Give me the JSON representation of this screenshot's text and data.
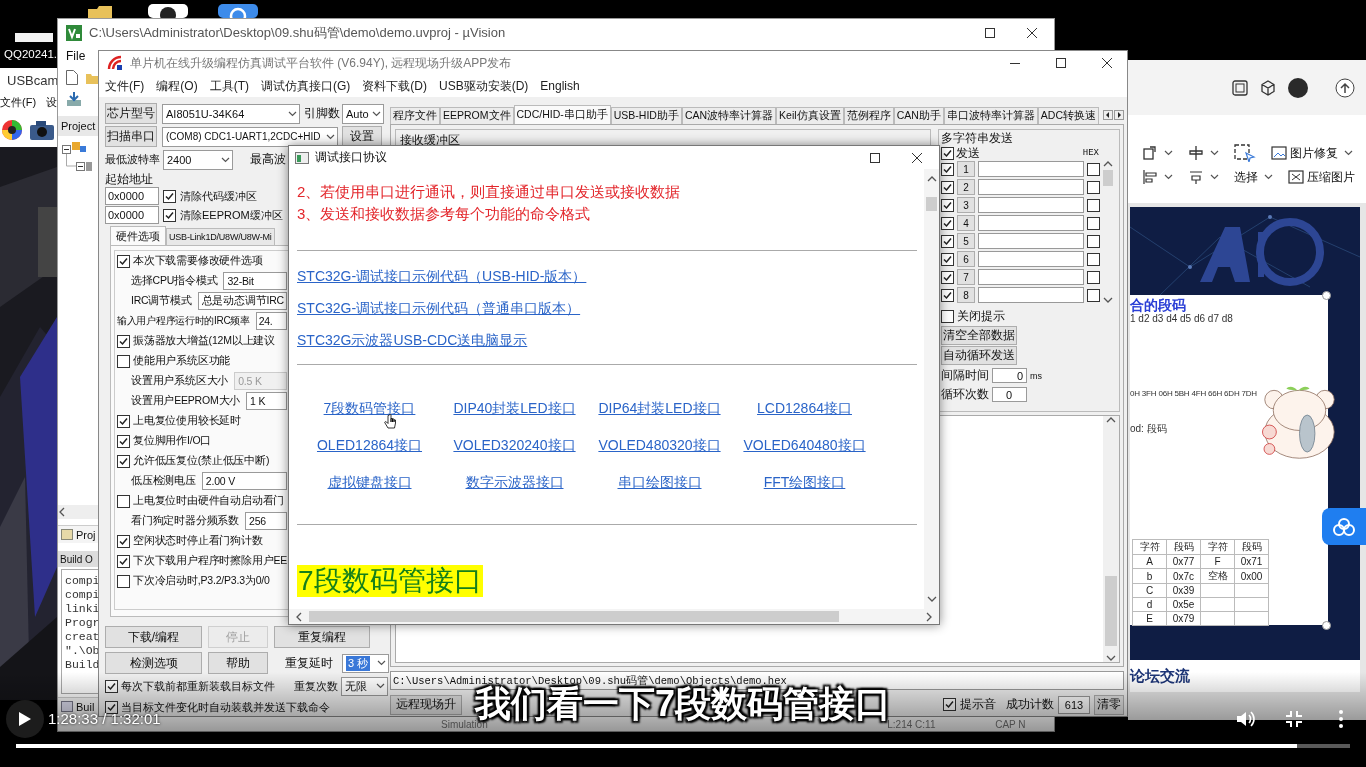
{
  "desktop": {
    "file_label": "QQ20241."
  },
  "usbcam_window": {
    "title": "USBcam",
    "menu": [
      "文件(F)",
      "设"
    ]
  },
  "keil_window": {
    "title": "C:\\Users\\Administrator\\Desktop\\09.shu码管\\demo\\demo.uvproj - µVision",
    "menu": [
      "File"
    ],
    "project_label": "Project",
    "project_tab": "Proj",
    "build_output_title": "Build O",
    "build_output_lines": [
      "compi",
      "compi",
      "linki",
      "Progr",
      "creat",
      "\".\\Ob",
      "Build"
    ],
    "build_tab": "Buil",
    "status_bar": [
      "Simulation",
      "L:214 C:11",
      "CAP N"
    ]
  },
  "isp_window": {
    "title": "单片机在线升级编程仿真调试平台软件 (V6.94Y), 远程现场升级APP发布",
    "menu": [
      "文件(F)",
      "编程(O)",
      "工具(T)",
      "调试仿真接口(G)",
      "资料下载(D)",
      "USB驱动安装(D)",
      "English"
    ],
    "chip_button": "芯片型号",
    "chip_select": "AI8051U-34K64",
    "pins_label": "引脚数",
    "pins_select": "Auto",
    "scan_button": "扫描串口",
    "port_select": "(COM8) CDC1-UART1,2CDC+HID",
    "settings_button": "设置",
    "min_baud_label": "最低波特率",
    "min_baud_select": "2400",
    "max_baud_label": "最高波",
    "start_address_label": "起始地址",
    "address_rows": [
      {
        "value": "0x0000",
        "label": "清除代码缓冲区",
        "checked": true
      },
      {
        "value": "0x0000",
        "label": "清除EEPROM缓冲区",
        "checked": true
      }
    ],
    "option_tabs": [
      {
        "label": "硬件选项",
        "selected": true
      },
      {
        "label": "USB-Link1D/U8W/U8W-Mi",
        "selected": false
      }
    ],
    "hardware_options": [
      {
        "kind": "checkbox",
        "label": "本次下载需要修改硬件选项",
        "checked": true
      },
      {
        "kind": "select",
        "label": "选择CPU指令模式",
        "value": "32-Bit",
        "disabled": false
      },
      {
        "kind": "select",
        "label": "IRC调节模式",
        "value": "总是动态调节IRC",
        "disabled": false
      },
      {
        "kind": "field",
        "label": "输入用户程序运行时的IRC频率",
        "value": "24.",
        "disabled": false
      },
      {
        "kind": "checkbox",
        "label": "振荡器放大增益(12M以上建议",
        "checked": true
      },
      {
        "kind": "checkbox",
        "label": "使能用户系统区功能",
        "checked": false
      },
      {
        "kind": "select",
        "label": "设置用户系统区大小",
        "value": "0.5 K",
        "disabled": true
      },
      {
        "kind": "select",
        "label": "设置用户EEPROM大小",
        "value": "1 K",
        "disabled": false
      },
      {
        "kind": "checkbox",
        "label": "上电复位使用较长延时",
        "checked": true
      },
      {
        "kind": "checkbox",
        "label": "复位脚用作I/O口",
        "checked": true
      },
      {
        "kind": "checkbox",
        "label": "允许低压复位(禁止低压中断)",
        "checked": true
      },
      {
        "kind": "select",
        "label": "低压检测电压",
        "value": "2.00 V",
        "disabled": false
      },
      {
        "kind": "checkbox",
        "label": "上电复位时由硬件自动启动看门",
        "checked": false
      },
      {
        "kind": "select",
        "label": "看门狗定时器分频系数",
        "value": "256",
        "disabled": false
      },
      {
        "kind": "checkbox",
        "label": "空闲状态时停止看门狗计数",
        "checked": true
      },
      {
        "kind": "checkbox",
        "label": "下次下载用户程序时擦除用户EE",
        "checked": true
      },
      {
        "kind": "checkbox",
        "label": "下次冷启动时,P3.2/P3.3为0/0",
        "checked": false
      }
    ],
    "button_rows": [
      [
        {
          "label": "下载/编程",
          "disabled": false
        },
        {
          "label": "停止",
          "disabled": true
        },
        {
          "label": "重复编程",
          "disabled": false
        }
      ],
      [
        {
          "label": "检测选项",
          "disabled": false
        },
        {
          "label": "帮助",
          "disabled": false
        }
      ]
    ],
    "repeat_delay": {
      "label": "重复延时",
      "value": "3 秒",
      "focused": true
    },
    "repeat_count": {
      "label": "重复次数",
      "value": "无限",
      "focused": false
    },
    "auto_options": [
      {
        "label": "每次下载前都重新装载目标文件",
        "checked": true
      },
      {
        "label": "当目标文件变化时自动装载并发送下载命令",
        "checked": true
      }
    ],
    "tabs": [
      {
        "label": "程序文件",
        "selected": false
      },
      {
        "label": "EEPROM文件",
        "selected": false
      },
      {
        "label": "CDC/HID-串口助手",
        "selected": true
      },
      {
        "label": "USB-HID助手",
        "selected": false
      },
      {
        "label": "CAN波特率计算器",
        "selected": false
      },
      {
        "label": "Keil仿真设置",
        "selected": false
      },
      {
        "label": "范例程序",
        "selected": false
      },
      {
        "label": "CAN助手",
        "selected": false
      },
      {
        "label": "串口波特率计算器",
        "selected": false
      },
      {
        "label": "ADC转换速",
        "selected": false
      }
    ],
    "receive_buffer_label": "接收缓冲区",
    "multi_send": {
      "title": "多字符串发送",
      "send_label": "发送",
      "send_checked": true,
      "hex_label": "HEX",
      "rows": [
        {
          "number": "1",
          "checked": true,
          "hex": false
        },
        {
          "number": "2",
          "checked": true,
          "hex": false
        },
        {
          "number": "3",
          "checked": true,
          "hex": false
        },
        {
          "number": "4",
          "checked": true,
          "hex": false
        },
        {
          "number": "5",
          "checked": true,
          "hex": false
        },
        {
          "number": "6",
          "checked": true,
          "hex": false
        },
        {
          "number": "7",
          "checked": true,
          "hex": false
        },
        {
          "number": "8",
          "checked": true,
          "hex": false
        }
      ],
      "close_hint": {
        "label": "关闭提示",
        "checked": false
      },
      "clear_button": "清空全部数据",
      "auto_button": "自动循环发送",
      "interval": {
        "label": "间隔时间",
        "value": "0",
        "unit": "ms"
      },
      "loop": {
        "label": "循环次数",
        "value": "0"
      }
    },
    "file_path": "C:\\Users\\Administrator\\Desktop\\09.shu码管\\demo\\Objects\\demo.hex",
    "remote_button": "远程现场升",
    "sound_hint": {
      "label": "提示音",
      "checked": true
    },
    "success_count": {
      "label": "成功计数",
      "value": "613"
    },
    "clear_count_button": "清零"
  },
  "protocol_dialog": {
    "title": "调试接口协议",
    "notes": [
      "2、若使用串口进行通讯，则直接通过串口发送或接收数据",
      "3、发送和接收数据参考每个功能的命令格式"
    ],
    "sample_links": [
      "STC32G-调试接口示例代码（USB-HID-版本）",
      "STC32G-调试接口示例代码（普通串口版本）",
      "STC32G示波器USB-CDC送电脑显示"
    ],
    "interface_links": [
      "7段数码管接口",
      "DIP40封装LED接口",
      "DIP64封装LED接口",
      "LCD12864接口",
      "OLED12864接口",
      "VOLED320240接口",
      "VOLED480320接口",
      "VOLED640480接口",
      "虚拟键盘接口",
      "数字示波器接口",
      "串口绘图接口",
      "FFT绘图接口"
    ],
    "heading": "7段数码管接口"
  },
  "wps_window": {
    "ribbon": {
      "picture_repair": "图片修复",
      "select": "选择",
      "compress": "压缩图片"
    },
    "slide": {
      "title_fragment": "合的段码",
      "digit_labels": "1 d2 d3 d4 d5 d6 d7 d8",
      "codes_line": "0H 3FH 06H 5BH 4FH 66H 6DH 7DH",
      "code_label": "od: 段码",
      "table": {
        "columns": [
          "字符",
          "段码",
          "字符",
          "段码"
        ],
        "rows": [
          [
            "A",
            "0x77",
            "F",
            "0x71"
          ],
          [
            "b",
            "0x7c",
            "空格",
            "0x00"
          ],
          [
            "C",
            "0x39"
          ],
          [
            "d",
            "0x5e"
          ],
          [
            "E",
            "0x79"
          ]
        ]
      },
      "footer": "论坛交流"
    }
  },
  "video": {
    "subtitle": "我们看一下7段数码管接口",
    "time": "1:28:33 / 1:32:01",
    "progress": {
      "level": 0.96
    }
  }
}
